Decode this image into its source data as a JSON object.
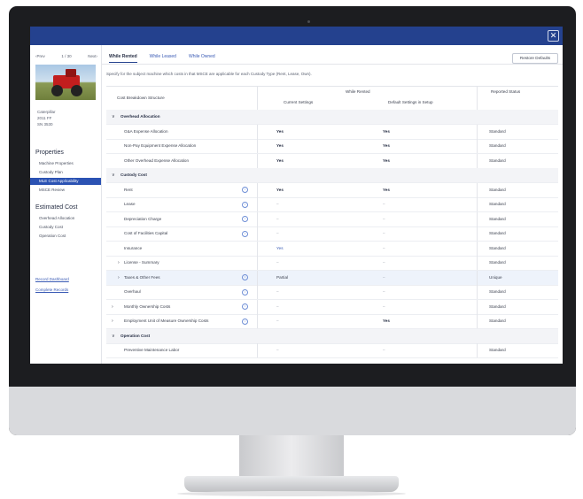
{
  "window": {
    "close_icon": "✕"
  },
  "sidebar": {
    "nav_prev": "‹Prev",
    "nav_pos": "1 / 30",
    "nav_next": "Next›",
    "machine_meta": [
      "Caterpillar",
      "2011 FF",
      "SN 3530"
    ],
    "properties_title": "Properties",
    "properties_items": [
      "Machine Properties",
      "Custody Plan",
      "MLE Cost Applicability",
      "MSCE Review"
    ],
    "active_index": 2,
    "estimated_title": "Estimated Cost",
    "estimated_items": [
      "Overhead Allocation",
      "Custody Cost",
      "Operation Cost"
    ],
    "links": [
      "Record Dashboard",
      "Complete Records"
    ]
  },
  "main": {
    "tabs": [
      "While Rented",
      "While Leased",
      "While Owned"
    ],
    "active_tab": 0,
    "restore_label": "Restore Defaults",
    "description": "Specify for the subject machine which costs in that MSCE are applicable for each Custody Type (Rent, Lease, Own).",
    "headers": {
      "structure": "Cost Breakdown Structure",
      "group": "While Rented",
      "current": "Current Settings",
      "default": "Default Settings in Setup",
      "status": "Reported Status"
    },
    "rows": [
      {
        "kind": "group",
        "label": "Overhead Allocation",
        "chev": "∨"
      },
      {
        "kind": "item",
        "label": "G&A Expense Allocation",
        "info": false,
        "current": "Yes",
        "default": "Yes",
        "status": "Standard"
      },
      {
        "kind": "item",
        "label": "Non-Pay Equipment Expense Allocation",
        "info": false,
        "current": "Yes",
        "default": "Yes",
        "status": "Standard"
      },
      {
        "kind": "item",
        "label": "Other Overhead Expense Allocation",
        "info": false,
        "current": "Yes",
        "default": "Yes",
        "status": "Standard"
      },
      {
        "kind": "group",
        "label": "Custody Cost",
        "chev": "∨"
      },
      {
        "kind": "item",
        "label": "Rent",
        "info": true,
        "current": "Yes",
        "default": "Yes",
        "status": "Standard"
      },
      {
        "kind": "item",
        "label": "Lease",
        "info": true,
        "current": "–",
        "default": "–",
        "status": "Standard"
      },
      {
        "kind": "item",
        "label": "Depreciation Charge",
        "info": true,
        "current": "–",
        "default": "–",
        "status": "Standard"
      },
      {
        "kind": "item",
        "label": "Cost of Facilities Capital",
        "info": true,
        "current": "–",
        "default": "–",
        "status": "Standard"
      },
      {
        "kind": "item",
        "label": "Insurance",
        "info": false,
        "current": "Yes",
        "default": "–",
        "status": "Standard",
        "current_link": true
      },
      {
        "kind": "sub",
        "label": "License - Summary",
        "chev": "›",
        "info": false,
        "current": "–",
        "default": "–",
        "status": "Standard"
      },
      {
        "kind": "sub",
        "label": "Taxes & Other Fees",
        "chev": "›",
        "info": true,
        "current": "Partial",
        "default": "–",
        "status": "Unique",
        "hl": true
      },
      {
        "kind": "item",
        "label": "Overhaul",
        "info": true,
        "current": "–",
        "default": "–",
        "status": "Standard"
      },
      {
        "kind": "sub0",
        "label": "Monthly Ownership Costs",
        "chev": "›",
        "info": true,
        "current": "–",
        "default": "–",
        "status": "Standard"
      },
      {
        "kind": "sub0",
        "label": "Employment Unit of Measure Ownership Costs",
        "chev": "›",
        "info": true,
        "current": "–",
        "default": "Yes",
        "status": "Standard"
      },
      {
        "kind": "group",
        "label": "Operation Cost",
        "chev": "∨"
      },
      {
        "kind": "item",
        "label": "Preventive Maintenance Labor",
        "info": false,
        "current": "–",
        "default": "–",
        "status": "Standard"
      }
    ]
  }
}
